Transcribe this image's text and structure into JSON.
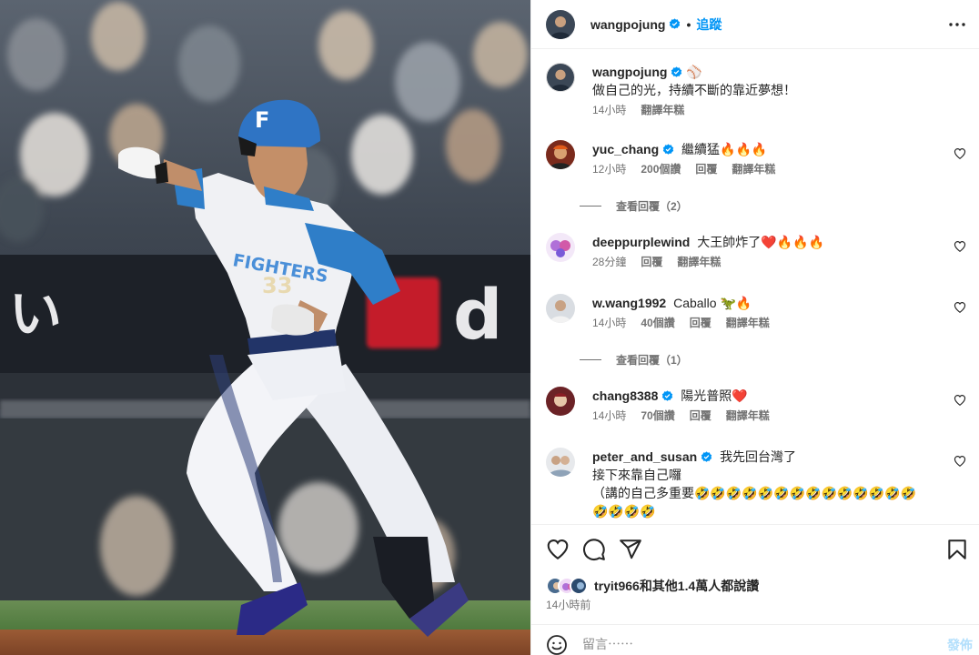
{
  "colors": {
    "accent": "#0095f6",
    "muted": "#737373",
    "text": "#262626",
    "verified": "#0095f6",
    "border": "#efefef",
    "post_disabled": "#b2dffc"
  },
  "header": {
    "username": "wangpojung",
    "dot": "•",
    "follow_label": "追蹤",
    "more_icon": "more-horizontal-icon"
  },
  "caption": {
    "username": "wangpojung",
    "emoji": "⚾",
    "text": "做自己的光，持續不斷的靠近夢想！",
    "time": "14小時",
    "translate": "翻譯年糕"
  },
  "comments": [
    {
      "username": "yuc_chang",
      "verified": true,
      "text": "繼續猛🔥🔥🔥",
      "time": "12小時",
      "likes": "200個讚",
      "reply": "回覆",
      "translate": "翻譯年糕",
      "view_replies": "查看回覆（2）"
    },
    {
      "username": "deeppurplewind",
      "verified": false,
      "text": "大王帥炸了❤️🔥🔥🔥",
      "time": "28分鐘",
      "reply": "回覆",
      "translate": "翻譯年糕"
    },
    {
      "username": "w.wang1992",
      "verified": false,
      "text": "Caballo 🦖🔥",
      "time": "14小時",
      "likes": "40個讚",
      "reply": "回覆",
      "translate": "翻譯年糕",
      "view_replies": "查看回覆（1）"
    },
    {
      "username": "chang8388",
      "verified": true,
      "text": "陽光普照❤️",
      "time": "14小時",
      "likes": "70個讚",
      "reply": "回覆",
      "translate": "翻譯年糕"
    },
    {
      "username": "peter_and_susan",
      "verified": true,
      "text_line1": "我先回台灣了",
      "text_line2": "接下來靠自己囉",
      "text_line3": "（講的自己多重要🤣🤣🤣🤣🤣🤣🤣🤣🤣🤣🤣🤣🤣🤣",
      "text_line4": "🤣🤣🤣🤣"
    }
  ],
  "actions": {
    "like_icon": "heart-icon",
    "comment_icon": "comment-icon",
    "share_icon": "share-icon",
    "save_icon": "bookmark-icon"
  },
  "likes": {
    "user": "tryit966",
    "rest": "和其他1.4萬人都說讚"
  },
  "post_time": "14小時前",
  "add_comment": {
    "placeholder": "留言⋯⋯",
    "post_label": "發佈"
  },
  "photo": {
    "jersey_text": "FIGHTERS",
    "number": "33",
    "helmet_letter": "F",
    "banner_text": "い",
    "banner_text_right": "d"
  }
}
